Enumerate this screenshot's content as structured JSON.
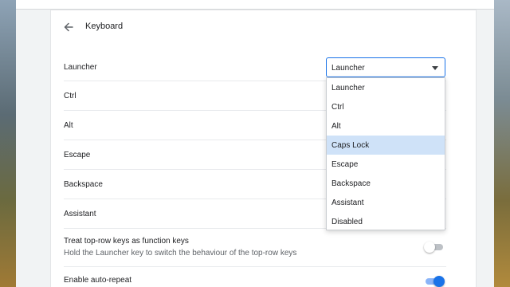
{
  "page": {
    "title": "Keyboard"
  },
  "rows": {
    "launcher": "Launcher",
    "ctrl": "Ctrl",
    "alt": "Alt",
    "escape": "Escape",
    "backspace": "Backspace",
    "assistant": "Assistant",
    "function_keys_title": "Treat top-row keys as function keys",
    "function_keys_sub": "Hold the Launcher key to switch the behaviour of the top-row keys",
    "auto_repeat": "Enable auto-repeat"
  },
  "launcher_select": {
    "value": "Launcher",
    "options": [
      "Launcher",
      "Ctrl",
      "Alt",
      "Caps Lock",
      "Escape",
      "Backspace",
      "Assistant",
      "Disabled"
    ],
    "highlighted": "Caps Lock"
  },
  "toggles": {
    "function_keys": false,
    "auto_repeat": true
  },
  "colors": {
    "accent": "#1a73e8",
    "highlight": "#cfe2f8",
    "divider": "#e8eaed"
  },
  "icons": {
    "back": "arrow-left-icon",
    "dropdown": "chevron-down-icon"
  }
}
